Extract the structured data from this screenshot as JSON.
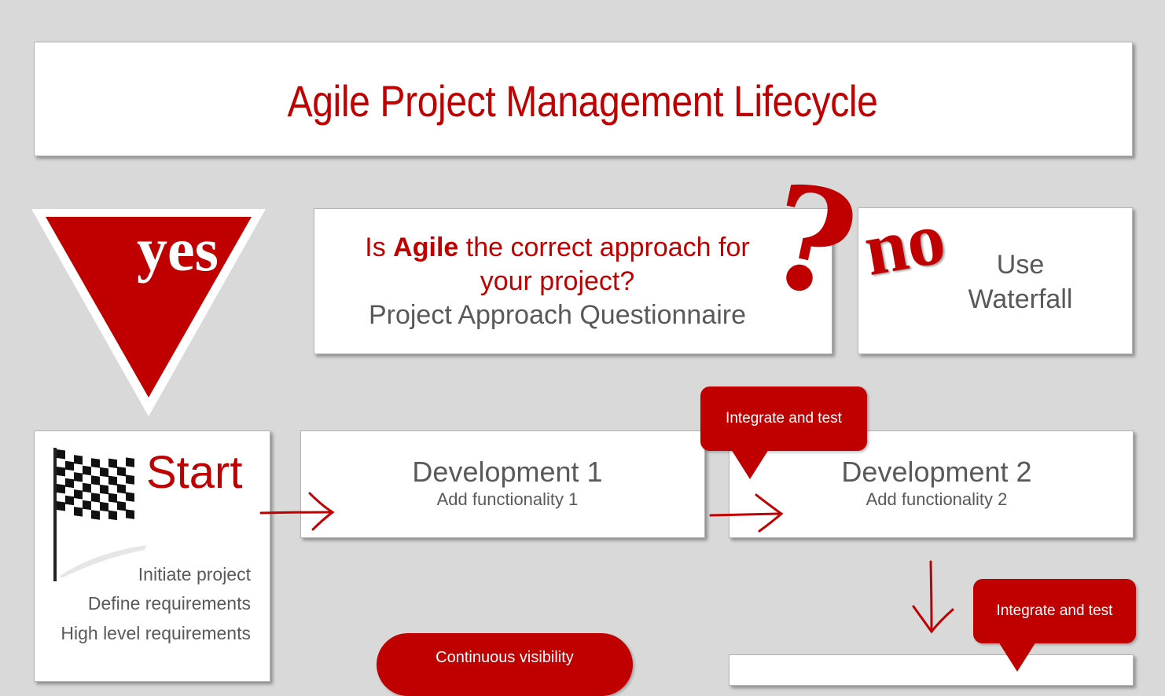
{
  "title": "Agile Project Management Lifecycle",
  "yes_label": "yes",
  "no_label": "no",
  "question": {
    "line1_prefix": "Is ",
    "line1_bold": "Agile",
    "line1_suffix": " the correct approach for",
    "line2": "your project?",
    "line3": "Project Approach Questionnaire",
    "mark": "?"
  },
  "waterfall": {
    "line1": "Use",
    "line2": "Waterfall"
  },
  "start": {
    "title": "Start",
    "items": [
      "Initiate project",
      "Define requirements",
      "High level requirements"
    ]
  },
  "development": [
    {
      "title": "Development 1",
      "subtitle": "Add functionality 1"
    },
    {
      "title": "Development 2",
      "subtitle": "Add functionality 2"
    }
  ],
  "callouts": [
    "Integrate and test",
    "Integrate and test",
    "Continuous visibility"
  ],
  "colors": {
    "accent": "#c00000",
    "text": "#595959",
    "background": "#d9d9d9"
  },
  "icons": [
    "checkered-flag-icon",
    "arrow-right-icon",
    "arrow-down-icon",
    "question-mark-icon"
  ]
}
